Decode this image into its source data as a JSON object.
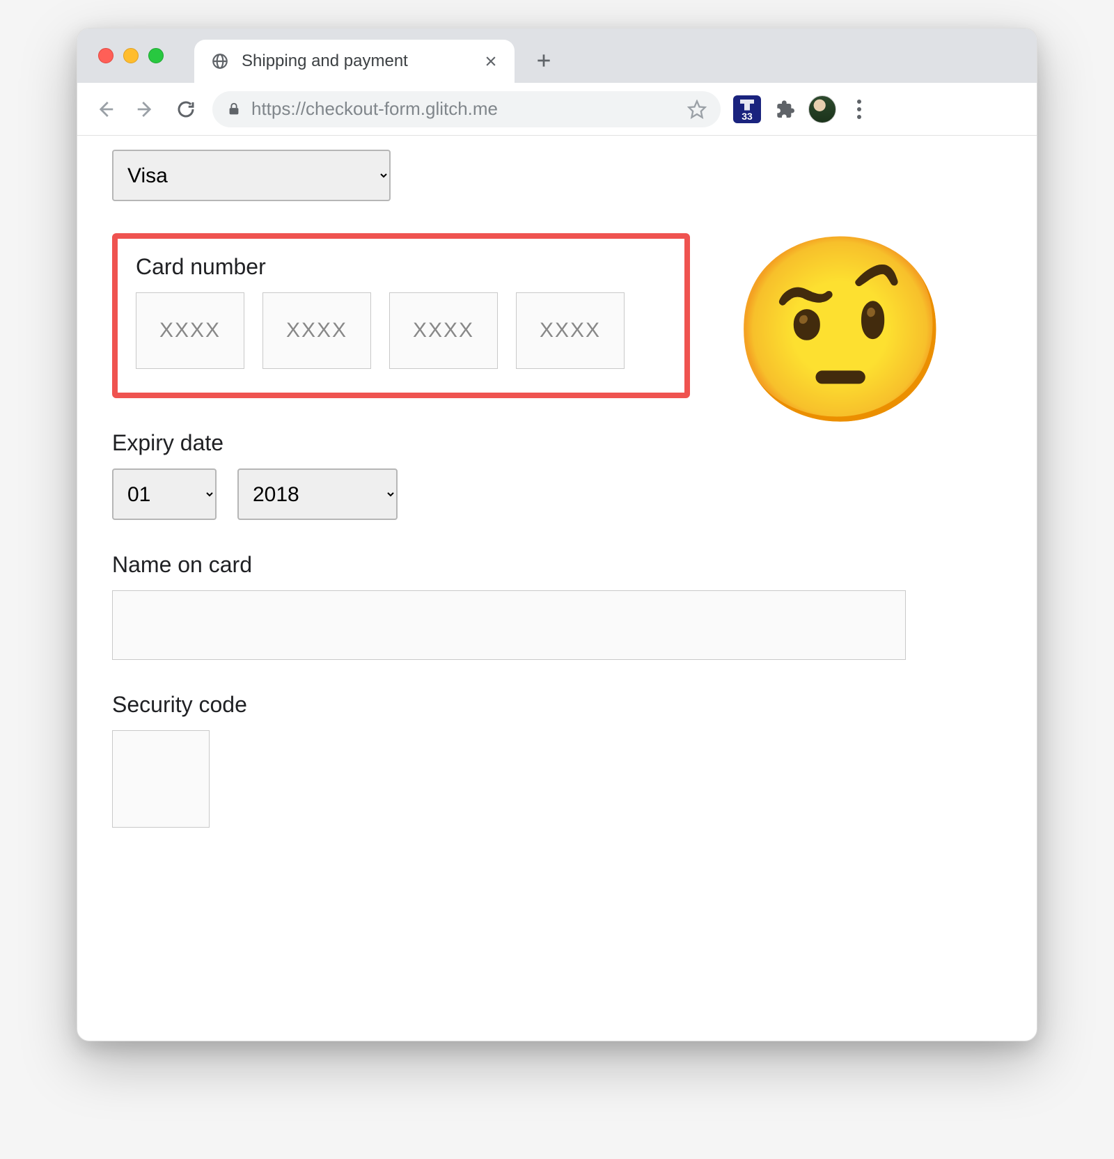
{
  "browser": {
    "tab_title": "Shipping and payment",
    "url": "https://checkout-form.glitch.me",
    "extension_badge": "33"
  },
  "form": {
    "card_type": {
      "value": "Visa"
    },
    "card_number": {
      "label": "Card number",
      "placeholder": "XXXX"
    },
    "expiry": {
      "label": "Expiry date",
      "month": "01",
      "year": "2018"
    },
    "name_on_card": {
      "label": "Name on card",
      "value": ""
    },
    "security_code": {
      "label": "Security code",
      "value": ""
    }
  },
  "annotation": {
    "emoji": "🤨"
  }
}
